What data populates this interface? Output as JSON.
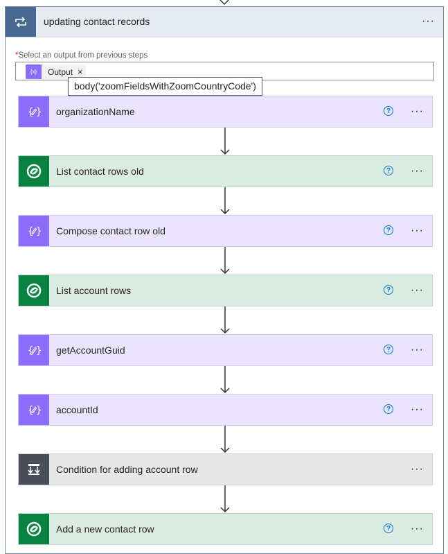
{
  "scope": {
    "title": "updating contact records",
    "icon": "loop-icon",
    "menu_label": "···"
  },
  "output_field": {
    "required_marker": "*",
    "label": "Select an output from previous steps",
    "token_label": "Output",
    "token_icon_text": "{x}",
    "token_close": "×"
  },
  "tooltip": "body('zoomFieldsWithZoomCountryCode')",
  "help_label": "?",
  "menu_label": "···",
  "steps": [
    {
      "title": "organizationName",
      "kind": "compose",
      "icon": "compose-icon",
      "help": true
    },
    {
      "title": "List contact rows old",
      "kind": "dataverse",
      "icon": "dataverse-icon",
      "help": true
    },
    {
      "title": "Compose contact row old",
      "kind": "compose",
      "icon": "compose-icon",
      "help": true
    },
    {
      "title": "List account rows",
      "kind": "dataverse",
      "icon": "dataverse-icon",
      "help": true
    },
    {
      "title": "getAccountGuid",
      "kind": "compose",
      "icon": "compose-icon",
      "help": true
    },
    {
      "title": "accountId",
      "kind": "compose",
      "icon": "compose-icon",
      "help": true
    },
    {
      "title": "Condition for adding account row",
      "kind": "condition",
      "icon": "condition-icon",
      "help": false
    },
    {
      "title": "Add a new contact row",
      "kind": "dataverse",
      "icon": "dataverse-icon",
      "help": true
    }
  ],
  "colors": {
    "scope_header": "#486991",
    "compose": "#8c6cfa",
    "dataverse": "#088142",
    "condition": "#484f58",
    "help": "#0078d4"
  }
}
